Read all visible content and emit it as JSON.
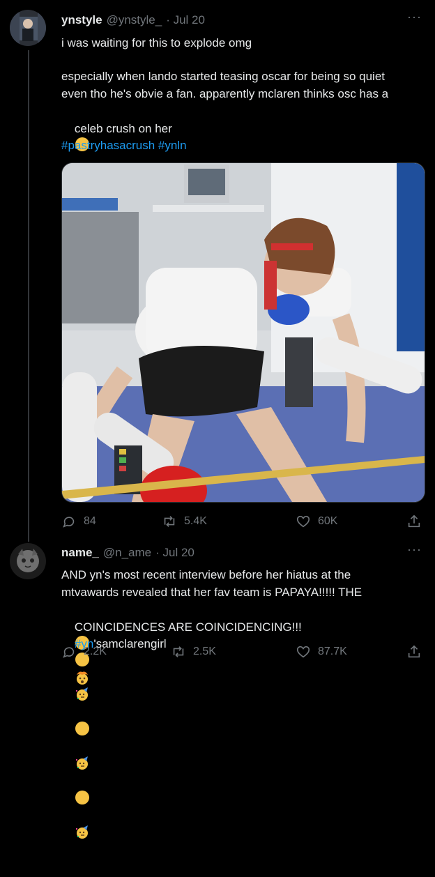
{
  "tweet1": {
    "display_name": "ynstyle",
    "handle": "@ynstyle_",
    "date": "· Jul 20",
    "line1": "i was waiting for this to explode omg",
    "line2": "especially when lando started teasing oscar for being so quiet",
    "line3": "even tho he's obvie a fan. apparently mclaren thinks osc has a",
    "line4": "celeb crush on her",
    "hashtags": "#pastryhasacrush #ynln",
    "emoji": "loudly-crying-face",
    "more": "···",
    "replies": "84",
    "retweets": "5.4K",
    "likes": "60K"
  },
  "tweet2": {
    "display_name": "name_",
    "handle": "@n_ame",
    "date": "· Jul 20",
    "line1": "AND yn's most recent interview before her hiatus at the",
    "line2": "mtvawards revealed that her fav team is PAPAYA!!!!! THE",
    "line3": "COINCIDENCES ARE COINCIDENCING!!!",
    "hashtag_part": "#yn",
    "line4_rest": "'samclarengirl",
    "emoji_line3": "exploding-head",
    "emoji_line4": "partying-face",
    "more": "···",
    "replies": "2.2K",
    "retweets": "2.5K",
    "likes": "87.7K"
  },
  "colors": {
    "background": "#000000",
    "text": "#e7e9ea",
    "secondary": "#71767b",
    "link": "#1d9bf0"
  }
}
